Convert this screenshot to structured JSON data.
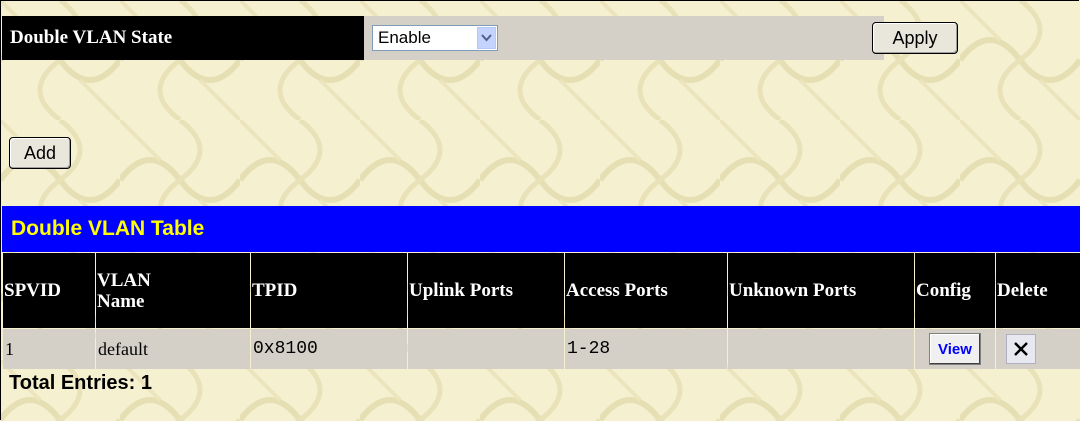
{
  "state": {
    "label": "Double VLAN State",
    "value": "Enable",
    "apply_label": "Apply"
  },
  "add_label": "Add",
  "table": {
    "title": "Double VLAN Table",
    "headers": [
      "SPVID",
      "VLAN Name",
      "TPID",
      "Uplink Ports",
      "Access Ports",
      "Unknown Ports",
      "Config",
      "Delete"
    ],
    "rows": [
      {
        "spvid": "1",
        "vlan_name": "default",
        "tpid": "0x8100",
        "uplink_ports": "",
        "access_ports": "1-28",
        "unknown_ports": "",
        "config_label": "View"
      }
    ]
  },
  "total_entries": "Total Entries: 1",
  "icons": {
    "select": "chevron-down-icon",
    "delete": "close-icon"
  },
  "colors": {
    "title_bar": "#0000ff",
    "title_text": "#ffff00",
    "header_bg": "#000000",
    "row_bg": "#d4d0c8"
  }
}
